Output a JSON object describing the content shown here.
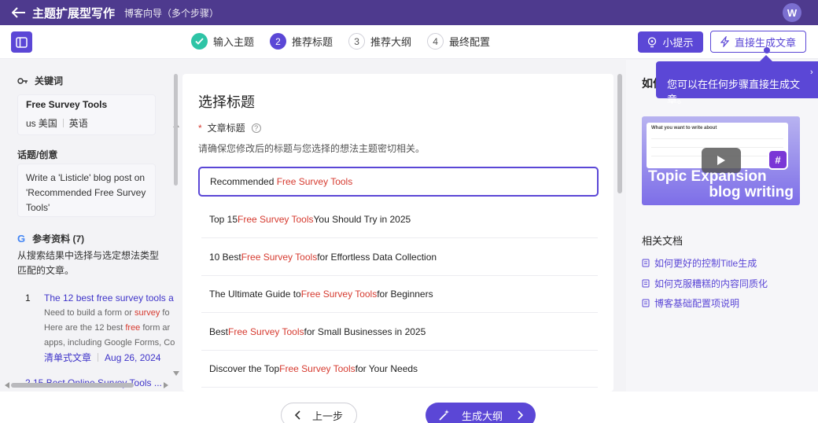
{
  "header": {
    "title": "主题扩展型写作",
    "subtitle": "博客向导（多个步骤）",
    "avatar_initial": "W"
  },
  "steps": [
    {
      "num": "✓",
      "label": "输入主题",
      "state": "done"
    },
    {
      "num": "2",
      "label": "推荐标题",
      "state": "active"
    },
    {
      "num": "3",
      "label": "推荐大纲",
      "state": "todo"
    },
    {
      "num": "4",
      "label": "最终配置",
      "state": "todo"
    }
  ],
  "toolbar": {
    "hint_label": "小提示",
    "generate_label": "直接生成文章"
  },
  "tooltip": {
    "text": "您可以在任何步骤直接生成文章。"
  },
  "left": {
    "keyword_heading": "关键词",
    "keyword": "Free Survey Tools",
    "country_code": "us",
    "country": "美国",
    "language": "英语",
    "idea_heading": "话题/创意",
    "idea_text": "Write a 'Listicle' blog post on 'Recommended Free Survey Tools'",
    "refs_heading": "参考资料 (7)",
    "refs_desc": "从搜索结果中选择与选定想法类型匹配的文章。",
    "ref1": {
      "index": "1",
      "title": "The 12 best free survey tools a",
      "snippet1_pre": "Need to build a form or ",
      "snippet1_hl": "survey",
      "snippet1_post": " fo",
      "snippet2_pre": "Here are the 12 best ",
      "snippet2_hl": "free",
      "snippet2_post": " form ar",
      "snippet3": "apps, including Google Forms, Co",
      "type": "清单式文章",
      "date": "Aug 26, 2024"
    },
    "ref2_partial": "2    15 Best Online Survey Tools ..."
  },
  "main": {
    "heading": "选择标题",
    "field_label": "文章标题",
    "field_hint": "请确保您修改后的标题与您选择的想法主题密切相关。",
    "input": {
      "pre": "Recommended ",
      "hl": "Free Survey Tools",
      "post": ""
    },
    "options": [
      {
        "pre": "Top 15 ",
        "hl": "Free Survey Tools",
        "post": " You Should Try in 2025"
      },
      {
        "pre": "10 Best ",
        "hl": "Free Survey Tools",
        "post": " for Effortless Data Collection"
      },
      {
        "pre": "The Ultimate Guide to ",
        "hl": "Free Survey Tools",
        "post": " for Beginners"
      },
      {
        "pre": "Best ",
        "hl": "Free Survey Tools",
        "post": " for Small Businesses in 2025"
      },
      {
        "pre": "Discover the Top ",
        "hl": "Free Survey Tools",
        "post": " for Your Needs"
      }
    ]
  },
  "right": {
    "title": "如何",
    "video_line1": "Topic Expansion",
    "video_line2": "blog writing",
    "video_mock_label": "What you want to write about",
    "docs_heading": "相关文档",
    "docs": [
      "如何更好的控制Title生成",
      "如何克服糟糕的内容同质化",
      "博客基础配置项说明"
    ]
  },
  "footer": {
    "prev_label": "上一步",
    "next_label": "生成大纲"
  },
  "colors": {
    "brand": "#5b47d6",
    "header": "#4e3a8e",
    "highlight": "#d63a2f",
    "done": "#2ec4a6"
  }
}
